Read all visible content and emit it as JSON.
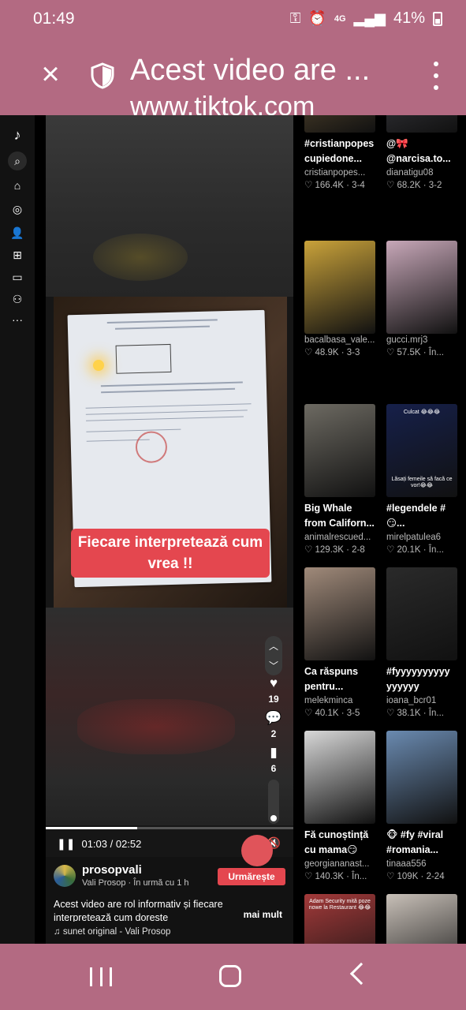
{
  "status": {
    "time": "01:49",
    "battery": "41%",
    "network": "4G"
  },
  "browser": {
    "title": "Acest video are ...",
    "url": "www.tiktok.com"
  },
  "video": {
    "caption_line1": "Fiecare interpretează cum",
    "caption_line2": "vrea !!",
    "likes": "19",
    "comments": "2",
    "saves": "6",
    "time": "01:03 / 02:52",
    "progress": 0.37,
    "volume": 0.1,
    "username": "prosopvali",
    "subline": "Vali Prosop · În urmă cu 1 h",
    "follow_label": "Urmărește",
    "description": "Acest video are rol informativ și fiecare interpretează cum doreste",
    "more_label": "mai mult",
    "sound": "♫ sunet original - Vali Prosop"
  },
  "grid": [
    {
      "title": "#cristianpopes",
      "title2": "cupiedone...",
      "user": "cristianpopes...",
      "stats": "♡ 166.4K · 3-4",
      "thumb": "#5a4a30"
    },
    {
      "title": "@🎀",
      "title2": "@narcisa.to...",
      "user": "dianatigu08",
      "stats": "♡ 68.2K · 3-2",
      "thumb": "#3a3a40"
    },
    {
      "title": "",
      "title2": "",
      "user": "bacalbasa_vale...",
      "stats": "♡ 48.9K · 3-3",
      "thumb": "#c9a23a"
    },
    {
      "title": "",
      "title2": "",
      "user": "gucci.mrj3",
      "stats": "♡ 57.5K · În...",
      "thumb": "#c7a7b8"
    },
    {
      "title": "Big Whale",
      "title2": "from Californ...",
      "user": "animalrescued...",
      "stats": "♡ 129.3K · 2-8",
      "thumb": "#6d6a62"
    },
    {
      "title": "#legendele #",
      "title2": "😏...",
      "user": "mirelpatulea6",
      "stats": "♡ 20.1K · În...",
      "thumb": "#16204a",
      "overlay1": "Culcat 😂😂😂",
      "overlay2": "Lăsați femeile să facă ce vor!😂😂"
    },
    {
      "title": "Ca răspuns",
      "title2": "pentru...",
      "user": "melekminca",
      "stats": "♡ 40.1K · 3-5",
      "thumb": "#a08a7a"
    },
    {
      "title": "#fyyyyyyyyyy",
      "title2": "yyyyyy",
      "user": "ioana_bcr01",
      "stats": "♡ 38.1K · În...",
      "thumb": "#2a2a2a"
    },
    {
      "title": "Fă cunoștință",
      "title2": "cu mama😏",
      "user": "georgiananast...",
      "stats": "♡ 140.3K · În...",
      "thumb": "#d8d8d8"
    },
    {
      "title": "🐵 #fy #viral",
      "title2": "#romania...",
      "user": "tinaaa556",
      "stats": "♡ 109K · 2-24",
      "thumb": "#6a8ab0"
    },
    {
      "title": "",
      "title2": "",
      "user": "",
      "stats": "",
      "thumb": "#a33a3a",
      "overlay1": "Adam Security mită poze nowe la Restaurant 😂😂"
    },
    {
      "title": "",
      "title2": "",
      "user": "",
      "stats": "",
      "thumb": "#c8c0b8"
    }
  ]
}
